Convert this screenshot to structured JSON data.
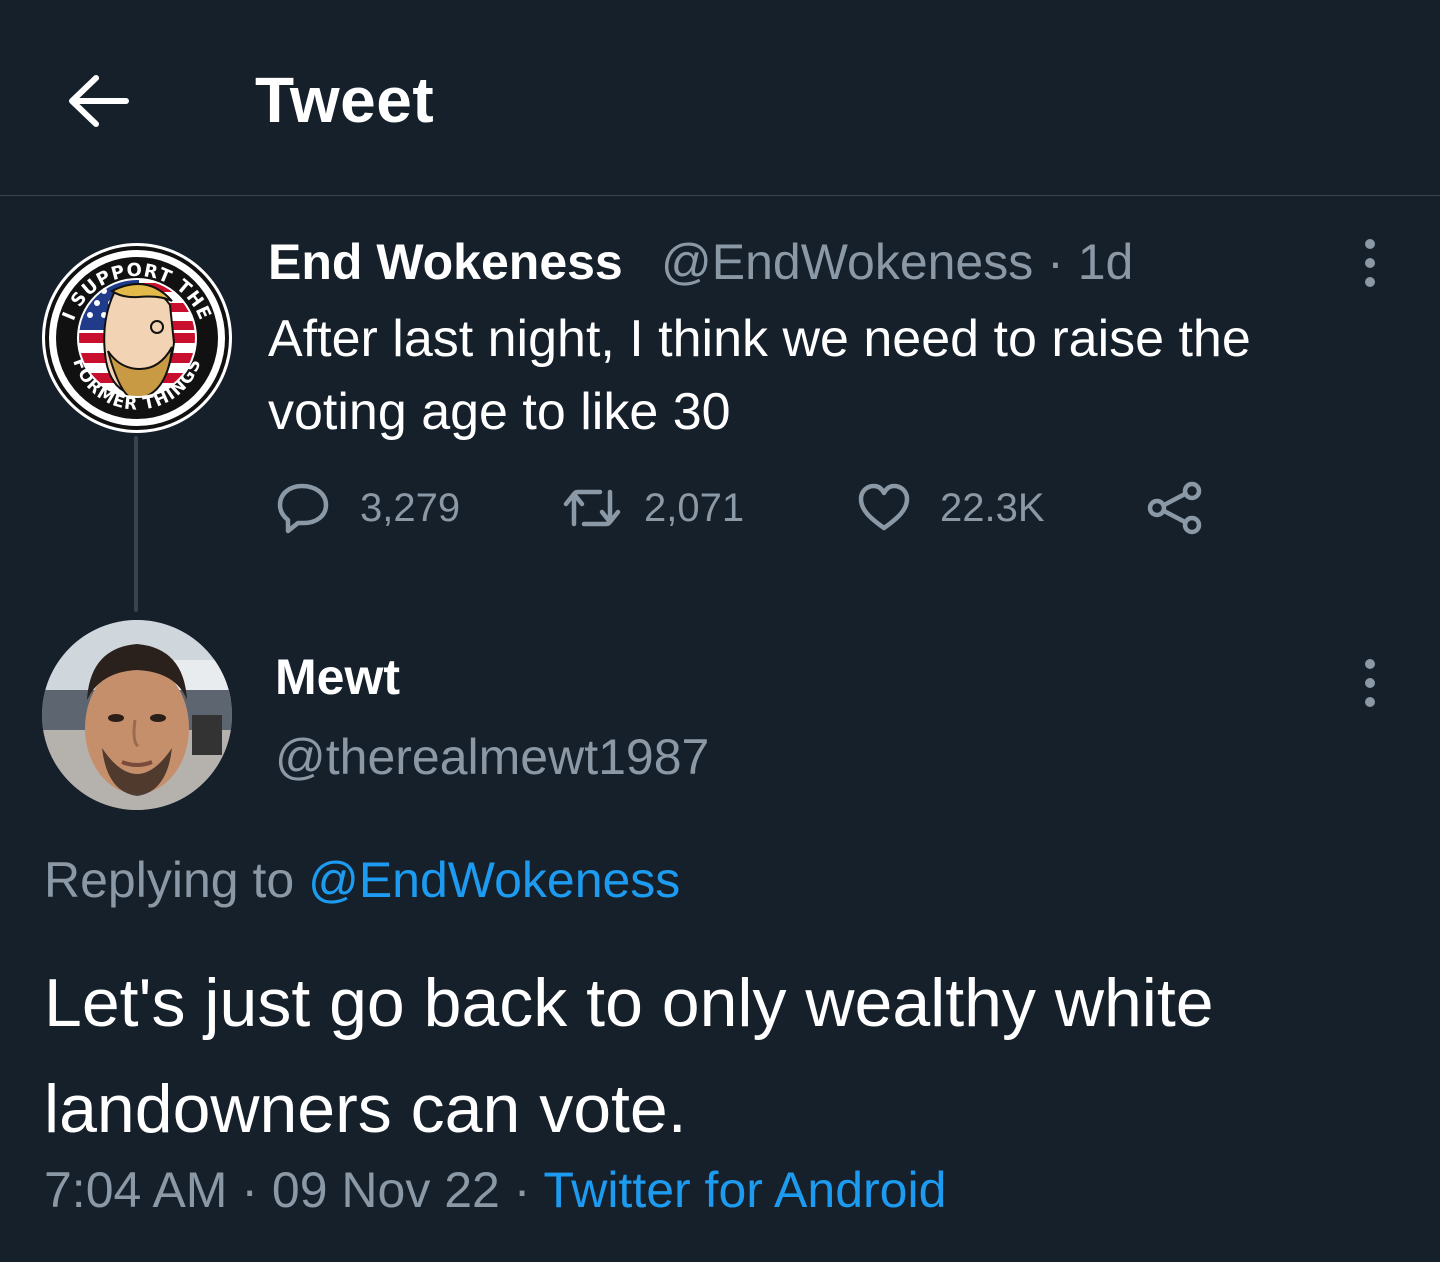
{
  "header": {
    "title": "Tweet"
  },
  "parent_tweet": {
    "display_name": "End Wokeness",
    "handle": "@EndWokeness",
    "separator": "·",
    "age": "1d",
    "text": "After last night, I think we need to raise the voting age to like 30",
    "avatar_badge_top": "I SUPPORT THE",
    "avatar_badge_bottom": "FORMER THINGS",
    "actions": {
      "replies": "3,279",
      "retweets": "2,071",
      "likes": "22.3K"
    }
  },
  "reply_tweet": {
    "display_name": "Mewt",
    "handle": "@therealmewt1987",
    "replying_to_label": "Replying to",
    "replying_to_handle": "@EndWokeness",
    "text": "Let's just go back to only wealthy white landowners can vote.",
    "time": "7:04 AM",
    "date": "09 Nov 22",
    "source": "Twitter for Android",
    "separator": "·"
  },
  "icons": {
    "back": "arrow-left-icon",
    "more": "more-vertical-icon",
    "reply": "speech-bubble-icon",
    "retweet": "retweet-icon",
    "like": "heart-icon",
    "share": "share-icon"
  },
  "colors": {
    "background": "#15202b",
    "primary_text": "#ffffff",
    "secondary_text": "#8b98a5",
    "accent": "#1d9bf0",
    "divider": "#38444d"
  }
}
